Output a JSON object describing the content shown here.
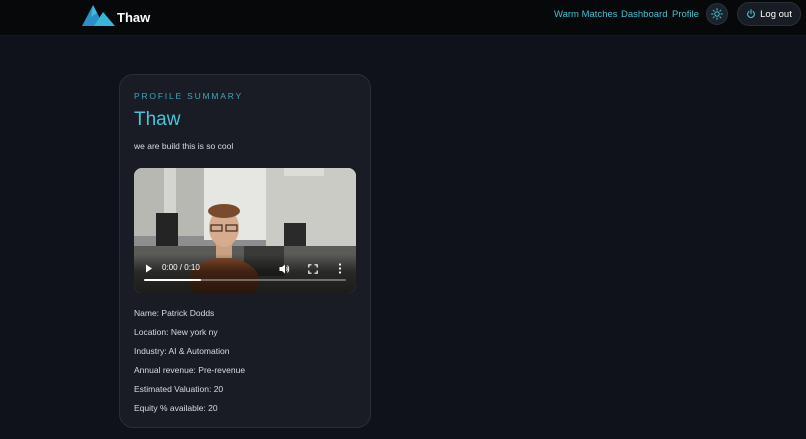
{
  "header": {
    "brand": "Thaw",
    "nav": [
      {
        "label": "Warm Matches"
      },
      {
        "label": "Dashboard"
      },
      {
        "label": "Profile"
      }
    ],
    "theme_icon": "sun-icon",
    "logout_icon": "power-icon",
    "logout_label": "Log out"
  },
  "profile": {
    "eyebrow": "PROFILE SUMMARY",
    "title": "Thaw",
    "description": "we are build this is so cool",
    "video": {
      "time": "0:00 / 0:10",
      "progress": 0.28
    },
    "details": [
      "Name: Patrick Dodds",
      "Location: New york ny",
      "Industry: AI & Automation",
      "Annual revenue: Pre-revenue",
      "Estimated Valuation: 20",
      "Equity % available: 20"
    ]
  },
  "colors": {
    "accent": "#45c7db",
    "background": "#0f121a",
    "card": "#191c24",
    "topbar": "#070809"
  }
}
